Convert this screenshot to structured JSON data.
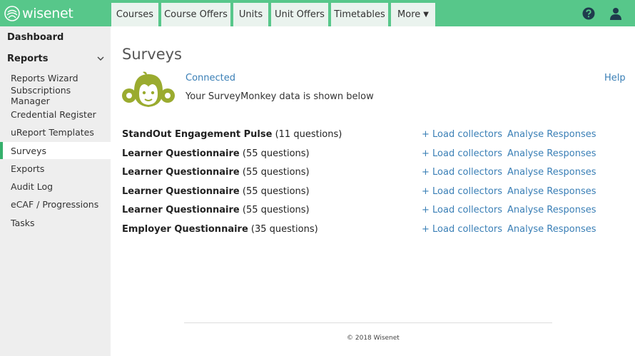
{
  "brand": {
    "name": "wisenet",
    "color": "#57c78a",
    "accent": "#36b06c",
    "link_color": "#3a7fb6"
  },
  "nav": {
    "tabs": [
      {
        "label": "Courses"
      },
      {
        "label": "Course Offers"
      },
      {
        "label": "Units"
      },
      {
        "label": "Unit Offers"
      },
      {
        "label": "Timetables"
      },
      {
        "label": "More"
      }
    ],
    "icons": [
      "help-icon",
      "user-icon"
    ]
  },
  "sidebar": {
    "dashboard": "Dashboard",
    "reports": "Reports",
    "items": [
      {
        "label": "Reports Wizard"
      },
      {
        "label": "Subscriptions Manager"
      },
      {
        "label": "Credential Register"
      },
      {
        "label": "uReport Templates"
      },
      {
        "label": "Surveys",
        "active": true
      },
      {
        "label": "Exports"
      },
      {
        "label": "Audit Log"
      },
      {
        "label": "eCAF / Progressions"
      },
      {
        "label": "Tasks"
      }
    ]
  },
  "main": {
    "title": "Surveys",
    "status": "Connected",
    "help": "Help",
    "info": "Your SurveyMonkey data is shown below",
    "surveys": [
      {
        "name": "StandOut Engagement Pulse",
        "count": "(11 questions)",
        "load": "+ Load collectors",
        "analyse": "Analyse Responses"
      },
      {
        "name": "Learner Questionnaire",
        "count": "(55 questions)",
        "load": "+ Load collectors",
        "analyse": "Analyse Responses"
      },
      {
        "name": "Learner Questionnaire",
        "count": "(55 questions)",
        "load": "+ Load collectors",
        "analyse": "Analyse Responses"
      },
      {
        "name": "Learner Questionnaire",
        "count": "(55 questions)",
        "load": "+ Load collectors",
        "analyse": "Analyse Responses"
      },
      {
        "name": "Learner Questionnaire",
        "count": "(55 questions)",
        "load": "+ Load collectors",
        "analyse": "Analyse Responses"
      },
      {
        "name": "Employer Questionnaire",
        "count": "(35 questions)",
        "load": "+ Load collectors",
        "analyse": "Analyse Responses"
      }
    ]
  },
  "footer": {
    "copyright": "© 2018 Wisenet"
  }
}
